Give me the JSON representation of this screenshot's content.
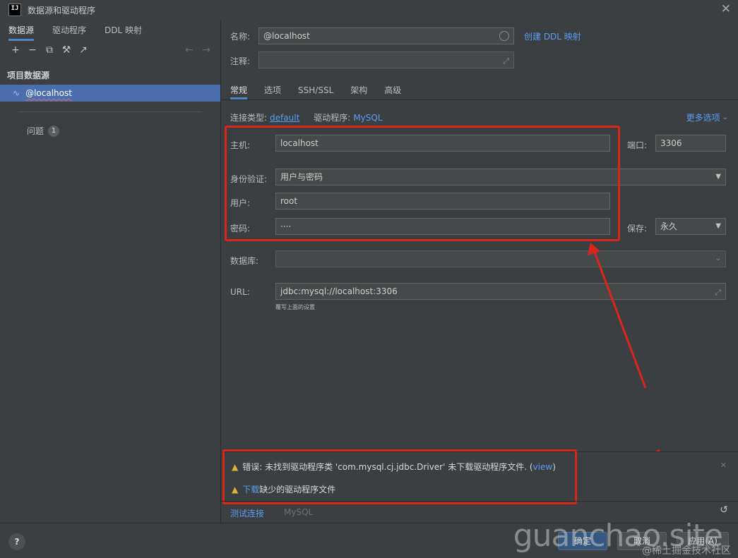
{
  "window": {
    "title": "数据源和驱动程序",
    "app_icon": "IJ"
  },
  "left": {
    "tabs": [
      "数据源",
      "驱动程序",
      "DDL 映射"
    ],
    "section_title": "项目数据源",
    "datasource": "@localhost",
    "problems_label": "问题",
    "problems_count": "1"
  },
  "right": {
    "name_label": "名称:",
    "name_value": "@localhost",
    "create_ddl": "创建 DDL 映射",
    "comment_label": "注释:",
    "tabs": [
      "常规",
      "选项",
      "SSH/SSL",
      "架构",
      "高级"
    ],
    "conn_type_label": "连接类型:",
    "conn_type_value": "default",
    "driver_label": "驱动程序:",
    "driver_value": "MySQL",
    "more_options": "更多选项",
    "host_label": "主机:",
    "host_value": "localhost",
    "port_label": "端口:",
    "port_value": "3306",
    "auth_label": "身份验证:",
    "auth_value": "用户与密码",
    "user_label": "用户:",
    "user_value": "root",
    "password_label": "密码:",
    "password_value": "····",
    "save_label": "保存:",
    "save_value": "永久",
    "database_label": "数据库:",
    "database_value": "",
    "url_label": "URL:",
    "url_value": "jdbc:mysql://localhost:3306",
    "url_hint": "覆写上面的设置"
  },
  "errors": {
    "error_prefix": "错误: 未找到驱动程序类 'com.mysql.cj.jdbc.Driver' 未下载驱动程序文件. (",
    "error_link": "view",
    "error_suffix": ")",
    "download_link": "下载",
    "download_text": "缺少的驱动程序文件"
  },
  "bottom": {
    "test_connection": "测试连接",
    "driver_name": "MySQL"
  },
  "footer": {
    "help": "?",
    "ok": "确定",
    "cancel": "取消",
    "apply": "应用(A)"
  },
  "watermark": {
    "main": "guanchao.site",
    "sub": "@稀土掘金技术社区"
  }
}
